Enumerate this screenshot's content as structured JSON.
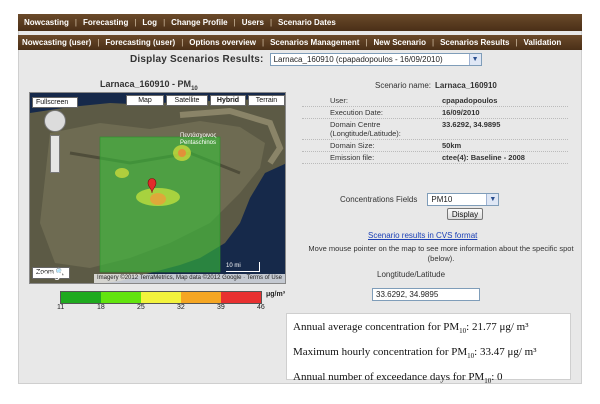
{
  "nav_primary": [
    "Nowcasting",
    "Forecasting",
    "Log",
    "Change Profile",
    "Users",
    "Scenario Dates"
  ],
  "nav_secondary": [
    "Nowcasting (user)",
    "Forecasting (user)",
    "Options overview",
    "Scenarios Management",
    "New Scenario",
    "Scenarios Results",
    "Validation"
  ],
  "scenario_select": {
    "label": "Display Scenarios Results:",
    "value": "Larnaca_160910 (cpapadopoulos - 16/09/2010)"
  },
  "map": {
    "title_prefix": "Larnaca_160910 - PM",
    "title_sub": "10",
    "buttons": [
      "Map",
      "Satellite",
      "Hybrid",
      "Terrain"
    ],
    "fullscreen_label": "Fullscreen",
    "zoom_label": "Zoom",
    "scale_label": "10 mi",
    "attribution": "Imagery ©2012 TerraMetrics, Map data ©2012 Google · Terms of Use",
    "logo_text": "Google",
    "place_labels": [
      "Πεντάσχοινος",
      "Pentaschinos"
    ]
  },
  "legend": {
    "colors": [
      "#1faa1f",
      "#62e40e",
      "#f3f33d",
      "#f5a623",
      "#e83030"
    ],
    "ticks": [
      "11",
      "18",
      "25",
      "32",
      "39",
      "46"
    ],
    "unit": "μg/m³"
  },
  "scenario_info": {
    "name_label": "Scenario name:",
    "name_value": "Larnaca_160910",
    "rows": [
      {
        "label": "User:",
        "value": "cpapadopoulos"
      },
      {
        "label": "Execution Date:",
        "value": "16/09/2010"
      },
      {
        "label": "Domain Centre (Longtitude/Latitude):",
        "value": "33.6292, 34.9895"
      },
      {
        "label": "Domain Size:",
        "value": "50km"
      },
      {
        "label": "Emission file:",
        "value": "ctee(4): Baseline - 2008"
      }
    ]
  },
  "concentration": {
    "label": "Concentrations Fields",
    "selected": "PM10",
    "display_button": "Display"
  },
  "links": {
    "csv": "Scenario results in CVS format"
  },
  "hint": "Move mouse pointer on the map to see more information about the specific spot (below).",
  "lonlat": {
    "label": "Longtitude/Latitude",
    "value": "33.6292, 34.9895"
  },
  "stats": {
    "line1_prefix": "Annual average concentration for PM",
    "line1_value": ": 21.77 μg/ m³",
    "line2_prefix": "Maximum hourly concentration for PM",
    "line2_value": ": 33.47 μg/ m³",
    "line3_prefix": "Annual number of exceedance days for PM",
    "line3_value": ": 0",
    "sub": "10"
  }
}
